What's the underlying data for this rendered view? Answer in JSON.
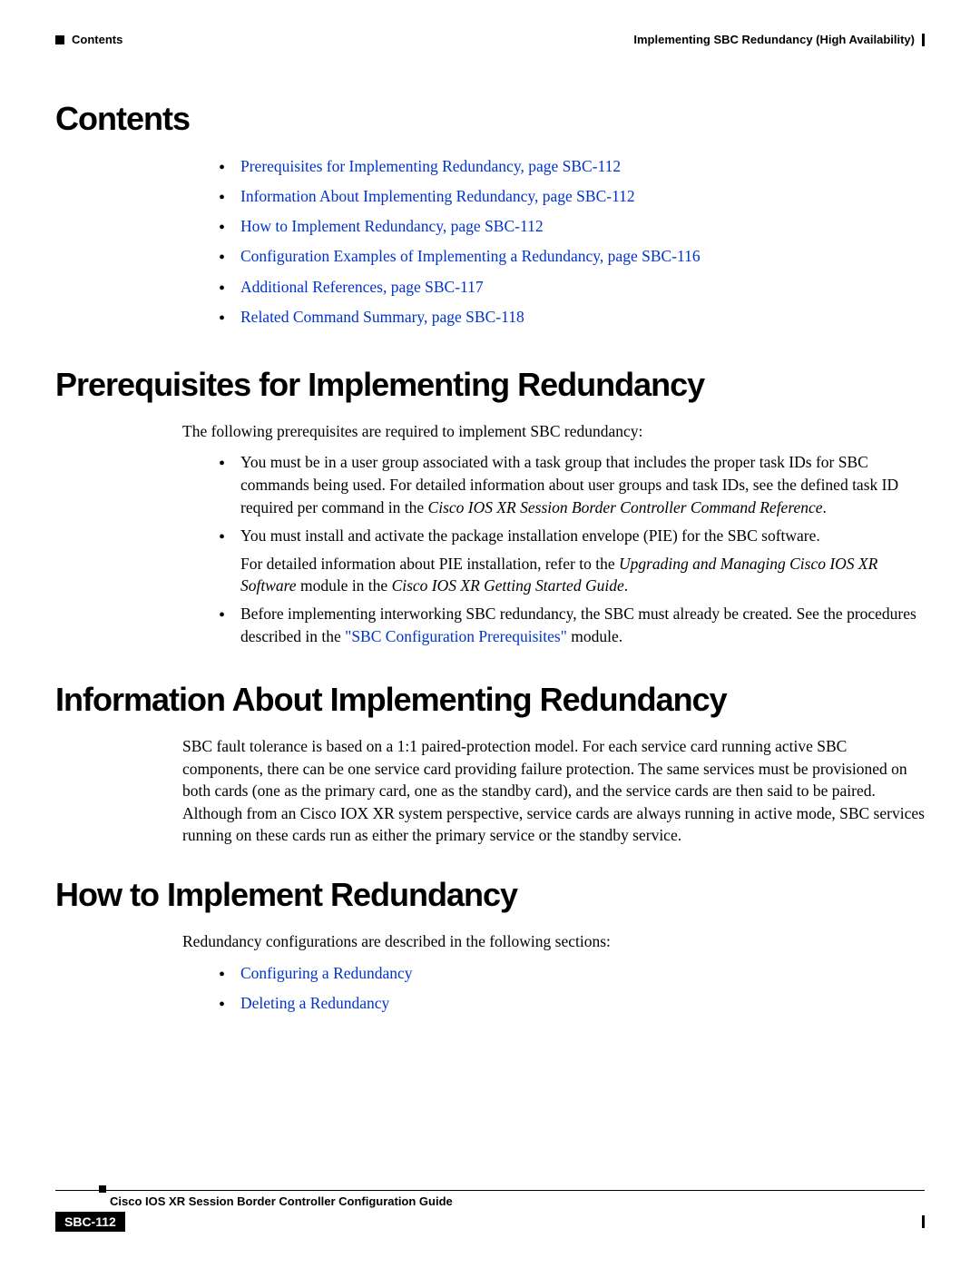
{
  "header": {
    "left": "Contents",
    "right": "Implementing SBC Redundancy (High Availability)"
  },
  "sections": {
    "contents_title": "Contents",
    "contents_links": [
      "Prerequisites for Implementing Redundancy, page SBC-112",
      "Information About Implementing Redundancy, page SBC-112",
      "How to Implement Redundancy, page SBC-112",
      "Configuration Examples of Implementing a Redundancy, page SBC-116",
      "Additional References, page SBC-117",
      "Related Command Summary, page SBC-118"
    ],
    "prereq_title": "Prerequisites for Implementing Redundancy",
    "prereq_intro": "The following prerequisites are required to implement SBC redundancy:",
    "prereq_b1a": "You must be in a user group associated with a task group that includes the proper task IDs for SBC commands being used. For detailed information about user groups and task IDs, see the defined task ID required per command in the ",
    "prereq_b1b": "Cisco IOS XR Session Border Controller Command Reference",
    "prereq_b1c": ".",
    "prereq_b2a": "You must install and activate the package installation envelope (PIE) for the SBC software.",
    "prereq_b2b": "For detailed information about PIE installation, refer to the ",
    "prereq_b2c": "Upgrading and Managing Cisco IOS XR Software",
    "prereq_b2d": " module in the ",
    "prereq_b2e": "Cisco IOS XR Getting Started Guide",
    "prereq_b2f": ".",
    "prereq_b3a": "Before implementing interworking SBC redundancy, the SBC must already be created. See the procedures described in the ",
    "prereq_b3b": "\"SBC Configuration Prerequisites\"",
    "prereq_b3c": " module.",
    "info_title": "Information About Implementing Redundancy",
    "info_body": "SBC fault tolerance is based on a 1:1 paired-protection model. For each service card running active SBC components, there can be one service card providing failure protection. The same services must be provisioned on both cards (one as the primary card, one as the standby card), and the service cards are then said to be paired. Although from an Cisco IOX XR system perspective, service cards are always running in active mode, SBC services running on these cards run as either the primary service or the standby service.",
    "howto_title": "How to Implement Redundancy",
    "howto_intro": "Redundancy configurations are described in the following sections:",
    "howto_links": [
      "Configuring a Redundancy",
      "Deleting a Redundancy"
    ]
  },
  "footer": {
    "guide": "Cisco IOS XR Session Border Controller Configuration Guide",
    "page": "SBC-112"
  }
}
